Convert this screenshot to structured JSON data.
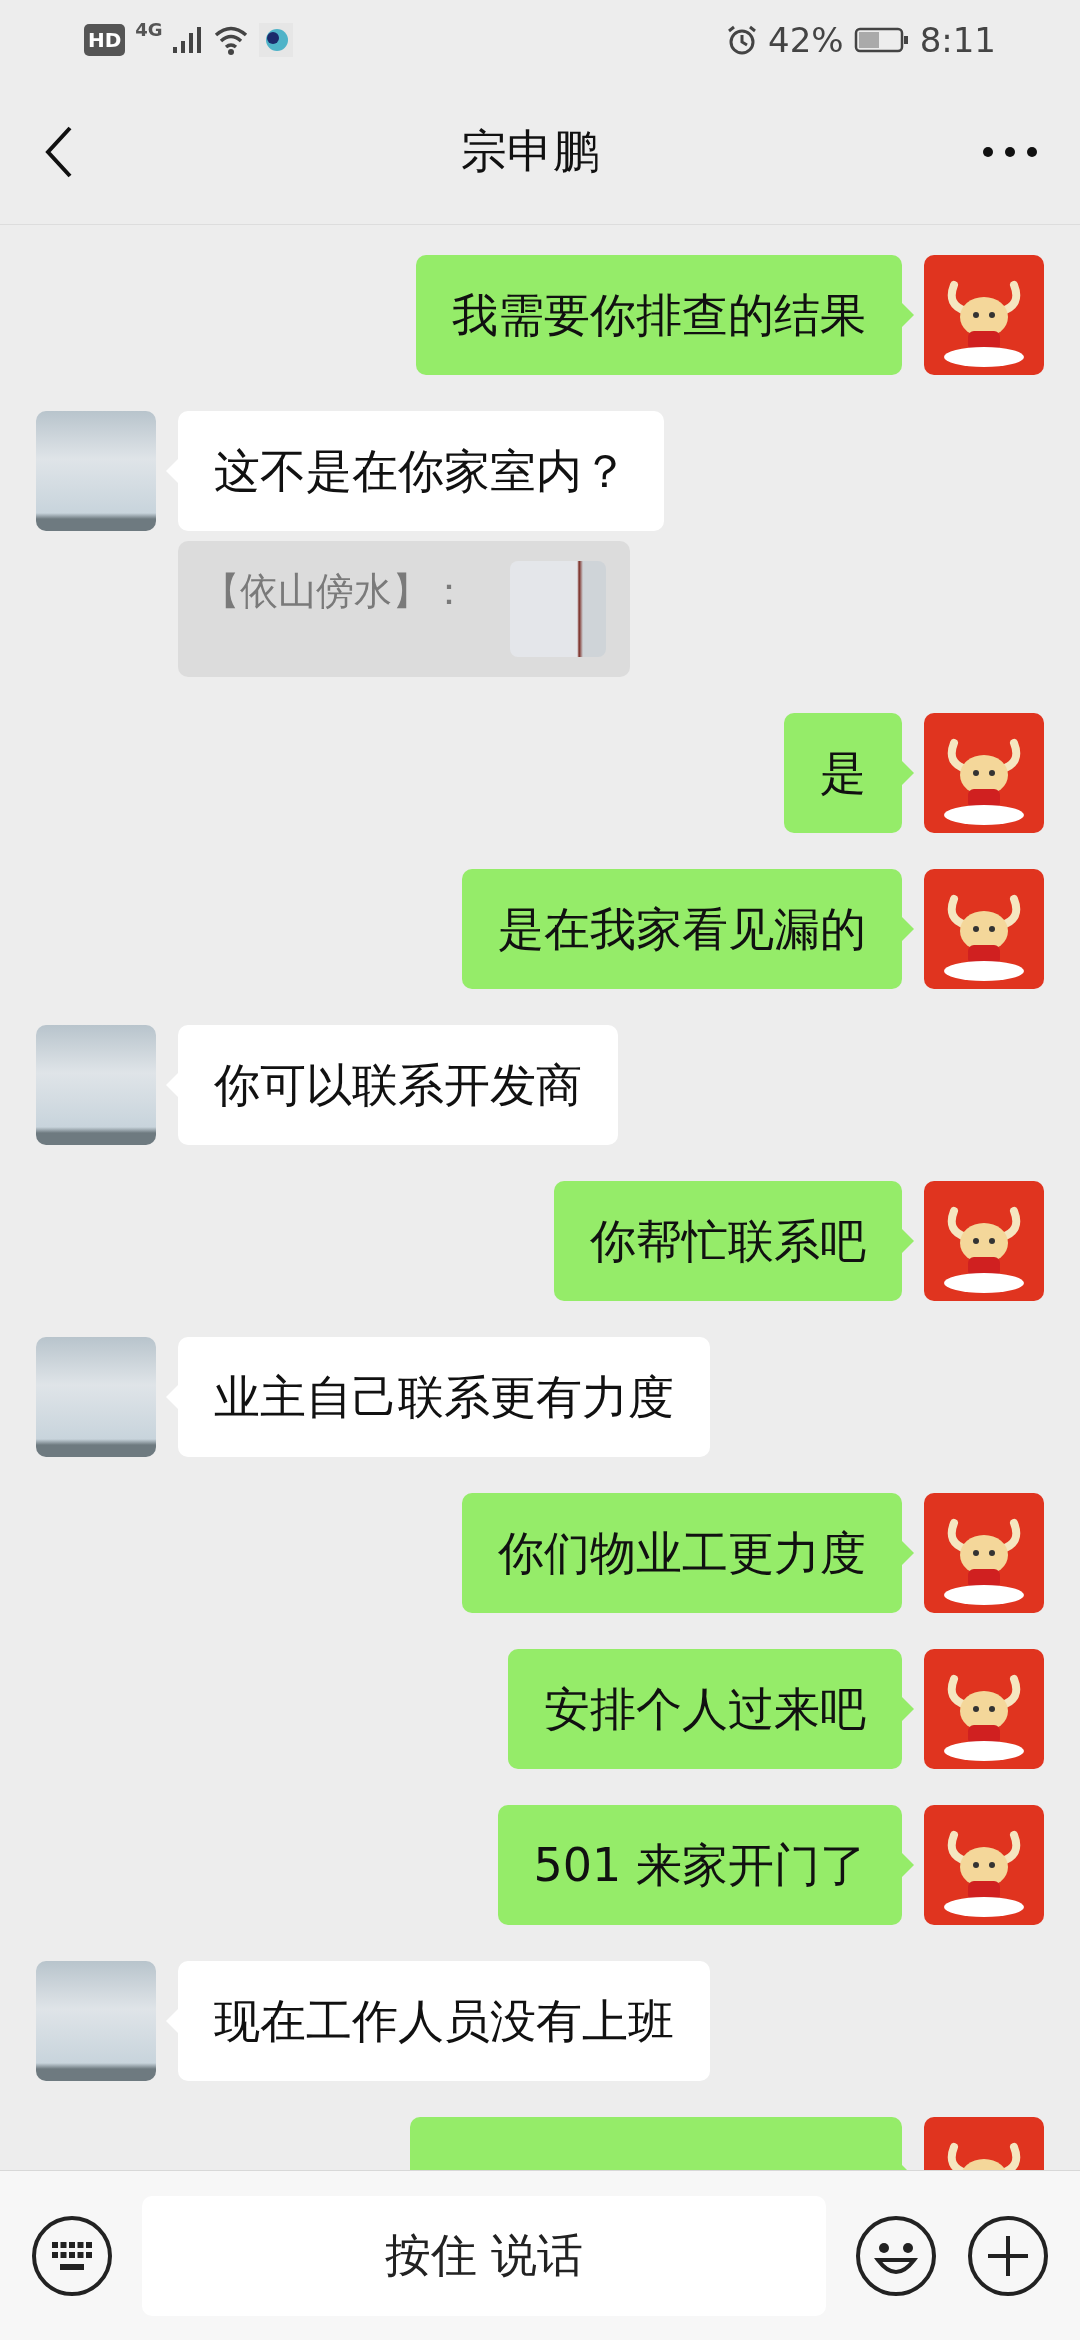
{
  "status_bar": {
    "hd": "HD",
    "network": "4G",
    "battery": "42%",
    "time": "8:11"
  },
  "header": {
    "title": "宗申鹏"
  },
  "messages": [
    {
      "kind": "sent",
      "text": "我需要你排查的结果"
    },
    {
      "kind": "received",
      "text": "这不是在你家室内？",
      "quote": {
        "text": "【依山傍水】："
      }
    },
    {
      "kind": "sent",
      "text": "是"
    },
    {
      "kind": "sent",
      "text": "是在我家看见漏的"
    },
    {
      "kind": "received",
      "text": "你可以联系开发商"
    },
    {
      "kind": "sent",
      "text": "你帮忙联系吧"
    },
    {
      "kind": "received",
      "text": "业主自己联系更有力度"
    },
    {
      "kind": "sent",
      "text": "你们物业工更力度"
    },
    {
      "kind": "sent",
      "text": "安排个人过来吧"
    },
    {
      "kind": "sent",
      "text": "501 来家开门了"
    },
    {
      "kind": "received",
      "text": "现在工作人员没有上班"
    },
    {
      "kind": "sent"
    }
  ],
  "input_bar": {
    "voice_button": "按住 说话"
  }
}
